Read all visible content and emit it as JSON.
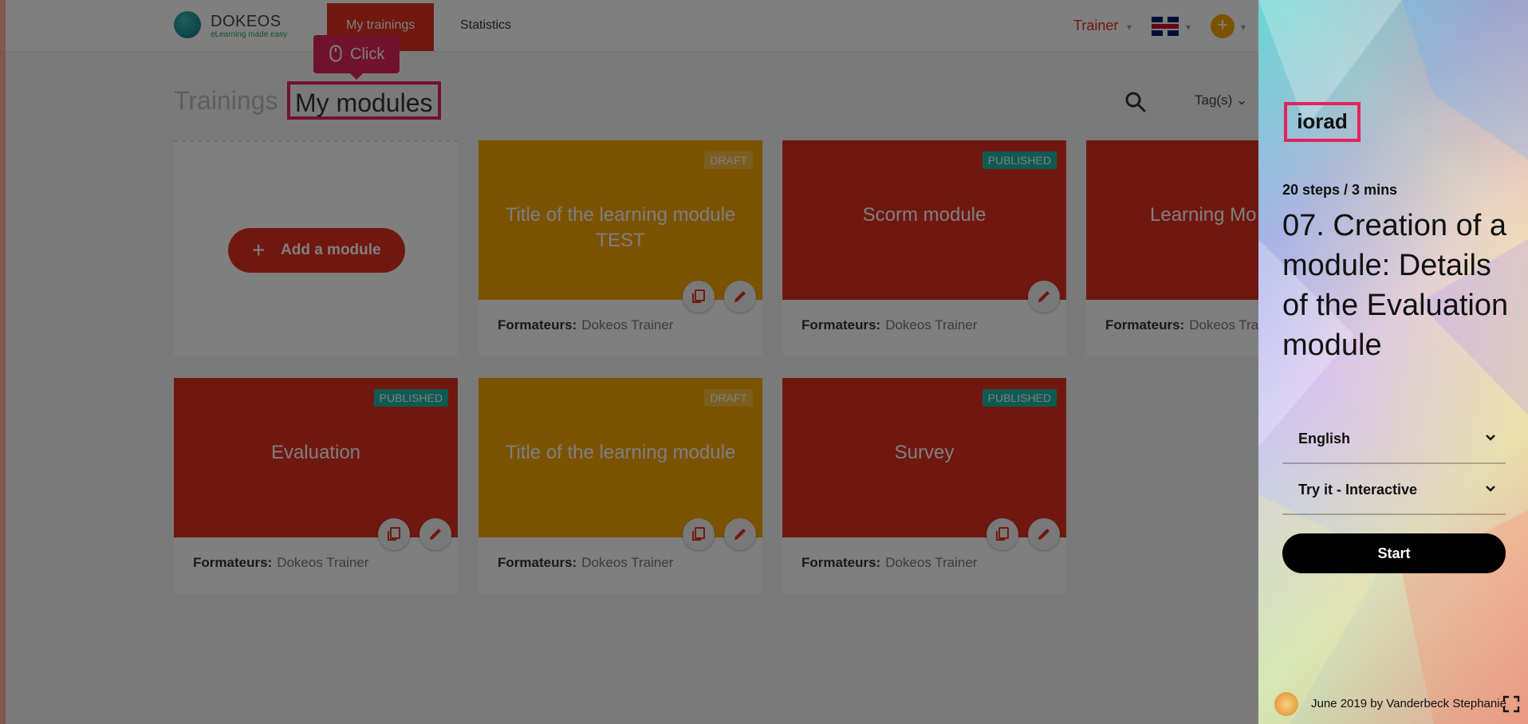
{
  "app": {
    "logo_name": "DOKEOS",
    "logo_tagline": "eLearning made easy",
    "nav": {
      "my_trainings": "My trainings",
      "statistics": "Statistics"
    },
    "role": "Trainer",
    "crumbs": {
      "trainings": "Trainings",
      "my_modules": "My modules"
    },
    "tags_label": "Tag(s)",
    "tooltip_label": "Click",
    "add_module_label": "Add a module",
    "trainer_label": "Formateurs:",
    "cards": [
      {
        "title": "Title of the learning module TEST",
        "status": "DRAFT",
        "color": "#f7a600",
        "trainer": "Dokeos Trainer"
      },
      {
        "title": "Scorm module",
        "status": "PUBLISHED",
        "color": "#e0301e",
        "trainer": "Dokeos Trainer"
      },
      {
        "title": "Learning Mo",
        "status": "",
        "color": "#e0301e",
        "trainer": "Dokeos Train"
      },
      {
        "title": "Evaluation",
        "status": "PUBLISHED",
        "color": "#e0301e",
        "trainer": "Dokeos Trainer"
      },
      {
        "title": "Title of the learning module",
        "status": "DRAFT",
        "color": "#f7a600",
        "trainer": "Dokeos Trainer"
      },
      {
        "title": "Survey",
        "status": "PUBLISHED",
        "color": "#e0301e",
        "trainer": "Dokeos Trainer"
      }
    ]
  },
  "panel": {
    "brand": "iorad",
    "steps": "20 steps / 3 mins",
    "title": "07. Creation of a module: Details of the Evaluation module",
    "language": "English",
    "mode": "Try it - Interactive",
    "start_label": "Start",
    "footer": "June 2019 by Vanderbeck Stephanie"
  },
  "colors": {
    "accent": "#e1245c",
    "brand_red": "#e0301e",
    "brand_orange": "#f7a600",
    "published": "#1fb5a5"
  }
}
